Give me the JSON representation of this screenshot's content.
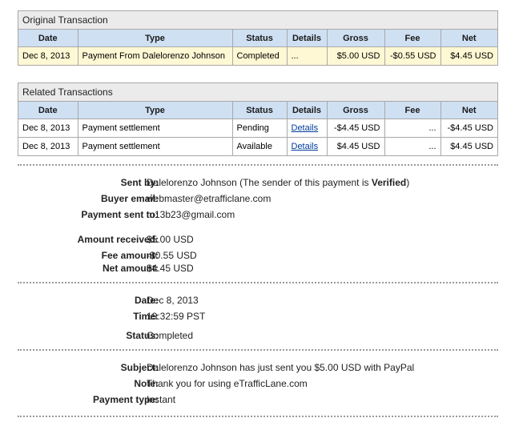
{
  "original": {
    "title": "Original Transaction",
    "headers": [
      "Date",
      "Type",
      "Status",
      "Details",
      "Gross",
      "Fee",
      "Net"
    ],
    "row": {
      "date": "Dec 8, 2013",
      "type": "Payment From Dalelorenzo Johnson",
      "status": "Completed",
      "details": "...",
      "gross": "$5.00 USD",
      "fee": "-$0.55 USD",
      "net": "$4.45 USD"
    }
  },
  "related": {
    "title": "Related Transactions",
    "headers": [
      "Date",
      "Type",
      "Status",
      "Details",
      "Gross",
      "Fee",
      "Net"
    ],
    "rows": [
      {
        "date": "Dec 8, 2013",
        "type": "Payment settlement",
        "status": "Pending",
        "details": "Details",
        "gross": "-$4.45 USD",
        "fee": "...",
        "net": "-$4.45 USD"
      },
      {
        "date": "Dec 8, 2013",
        "type": "Payment settlement",
        "status": "Available",
        "details": "Details",
        "gross": "$4.45 USD",
        "fee": "...",
        "net": "$4.45 USD"
      }
    ]
  },
  "info": {
    "sent_by_label": "Sent by:",
    "sent_by_name": "Dalelorenzo Johnson",
    "sent_by_note_pre": "(The sender of this payment is",
    "sent_by_verified": "Verified",
    "sent_by_note_post": ")",
    "buyer_email_label": "Buyer email:",
    "buyer_email": "webmaster@etrafficlane.com",
    "sent_to_label": "Payment sent to:",
    "sent_to": "m13b23@gmail.com",
    "amount_label": "Amount received:",
    "amount": "$5.00 USD",
    "fee_label": "Fee amount:",
    "fee": "-$0.55 USD",
    "net_label": "Net amount:",
    "net": "$4.45 USD",
    "date_label": "Date:",
    "date": "Dec 8, 2013",
    "time_label": "Time:",
    "time": "19:32:59 PST",
    "status_label": "Status:",
    "status": "Completed",
    "subject_label": "Subject:",
    "subject": "Dalelorenzo Johnson has just sent you $5.00 USD with PayPal",
    "note_label": "Note:",
    "note": "Thank you for using eTrafficLane.com",
    "ptype_label": "Payment type:",
    "ptype": "Instant"
  }
}
